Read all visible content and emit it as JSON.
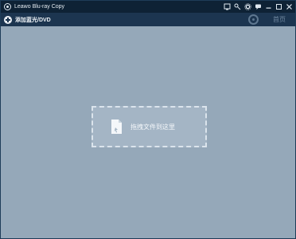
{
  "window": {
    "title": "Leawo Blu-ray Copy"
  },
  "toolbar": {
    "add_label": "添加蓝光/DVD",
    "home_label": "首页"
  },
  "dropzone": {
    "text": "拖拽文件到这里"
  },
  "colors": {
    "titlebar": "#0e2235",
    "toolbar": "#1c3550",
    "workspace": "#95a8b9",
    "dropzone": "#a4b5c5"
  },
  "icons": {
    "title_controls": [
      "registration-icon",
      "key-icon",
      "settings-icon",
      "chat-icon",
      "minimize-icon",
      "maximize-icon",
      "close-icon"
    ]
  }
}
